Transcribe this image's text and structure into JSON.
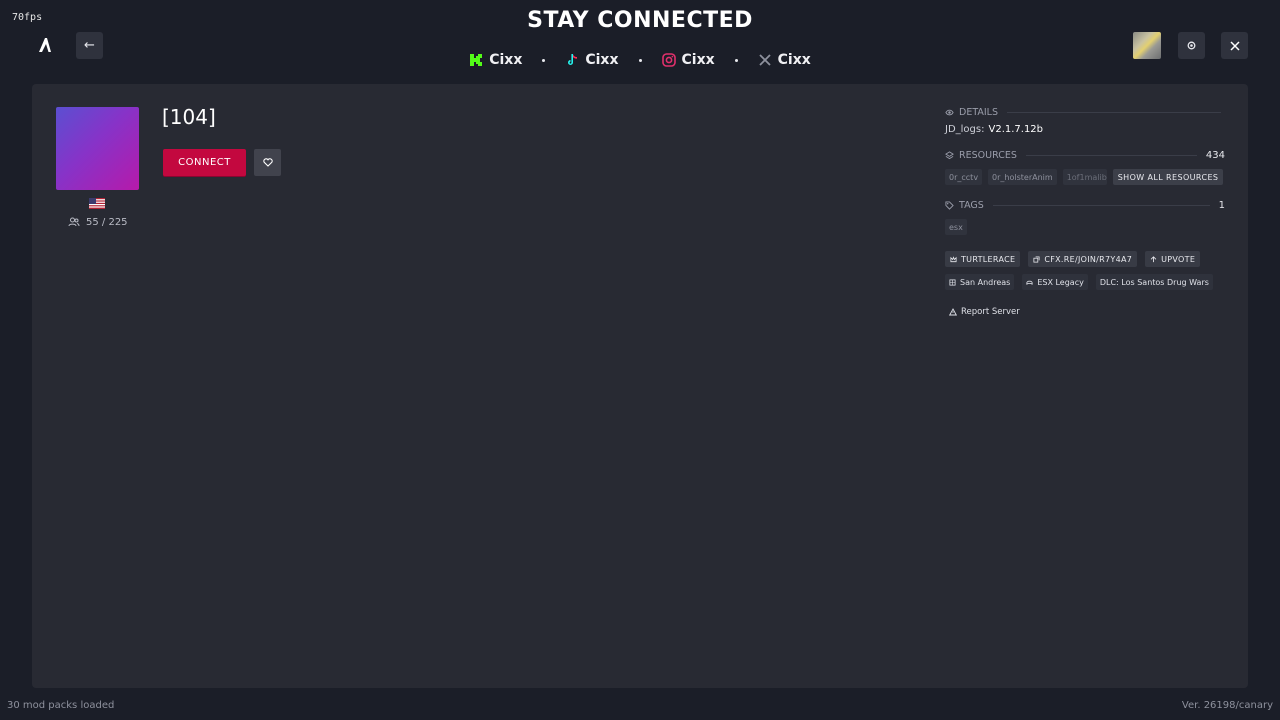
{
  "fps": "70fps",
  "headline": "STAY CONNECTED",
  "socials": [
    {
      "icon": "kick-icon",
      "label": "Cixx",
      "color": "#53fc18"
    },
    {
      "icon": "tiktok-icon",
      "label": "Cixx",
      "color": "#25f4ee"
    },
    {
      "icon": "instagram-icon",
      "label": "Cixx",
      "color": "#e1306c"
    },
    {
      "icon": "x-icon",
      "label": "Cixx",
      "color": "#8e919d"
    }
  ],
  "server": {
    "name": "[104]",
    "connect_label": "CONNECT",
    "players": "55 / 225",
    "flag": "us-flag-icon"
  },
  "details": {
    "heading": "DETAILS",
    "key": "JD_logs:",
    "value": "V2.1.7.12b"
  },
  "resources": {
    "heading": "RESOURCES",
    "count": "434",
    "items": [
      "0r_cctv",
      "0r_holsterAnim",
      "1of1malib"
    ],
    "show_all_label": "SHOW ALL RESOURCES"
  },
  "tags": {
    "heading": "TAGS",
    "count": "1",
    "items": [
      "esx"
    ]
  },
  "badges": [
    {
      "icon": "crown-icon",
      "label": "TURTLERACE"
    },
    {
      "icon": "link-icon",
      "label": "CFX.RE/JOIN/R7Y4A7"
    },
    {
      "icon": "arrow-up-icon",
      "label": "UPVOTE"
    }
  ],
  "meta": [
    {
      "icon": "map-icon",
      "label": "San Andreas"
    },
    {
      "icon": "gamepad-icon",
      "label": "ESX Legacy"
    },
    {
      "icon": "",
      "label": "DLC: Los Santos Drug Wars"
    }
  ],
  "report_label": "Report Server",
  "footer": {
    "left": "30 mod packs loaded",
    "right": "Ver. 26198/canary"
  },
  "colors": {
    "background": "#1b1e28",
    "panel": "#282a33",
    "connect": "#c3083f"
  }
}
